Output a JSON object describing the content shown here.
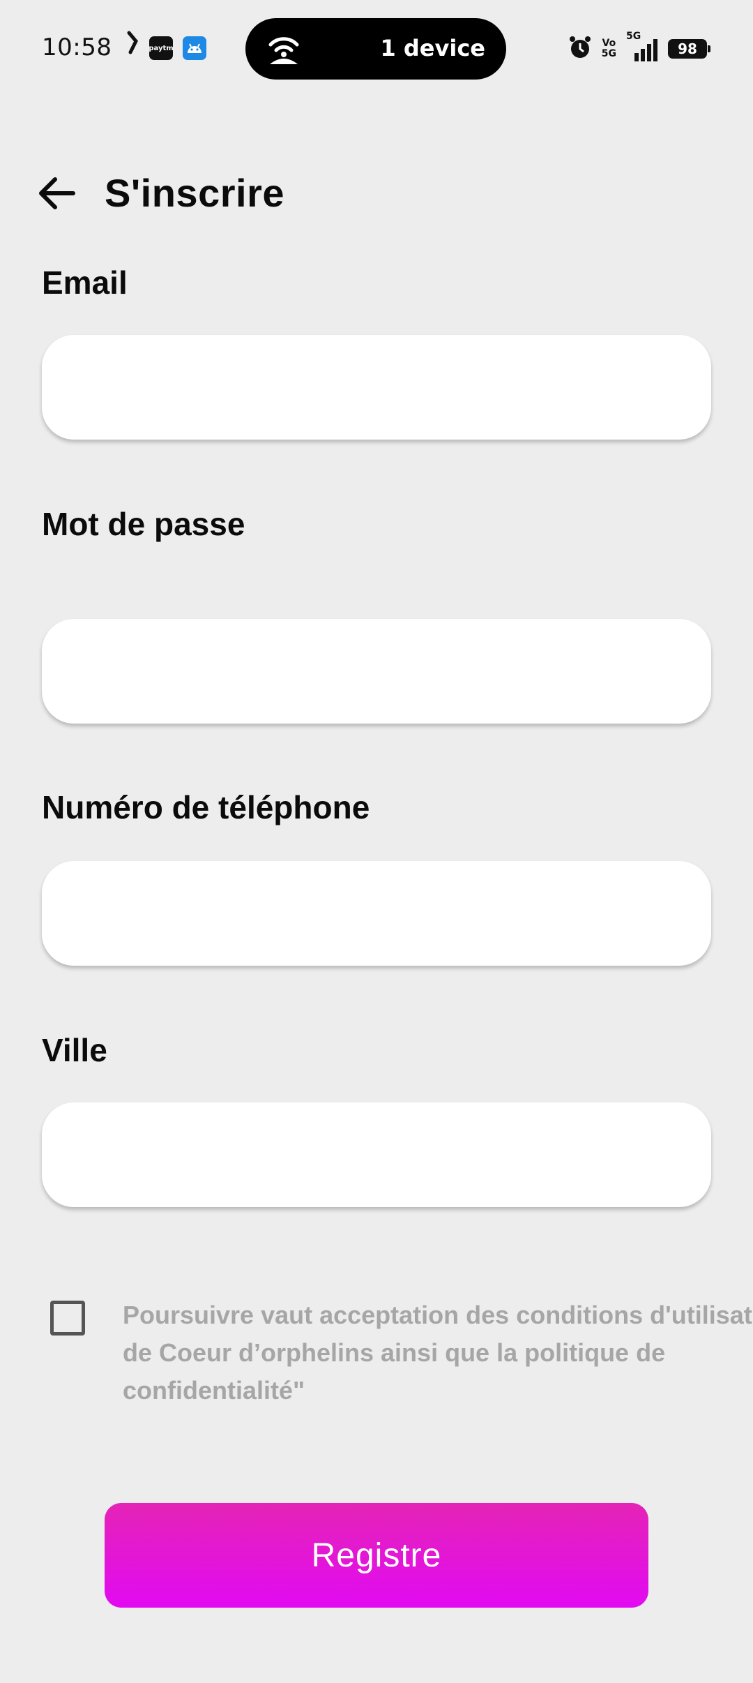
{
  "status_bar": {
    "time": "10:58",
    "paytm_label": "paytm",
    "hotspot_text": "1 device",
    "volte_line1": "Vo",
    "volte_line2": "5G",
    "network_label": "5G",
    "battery": "98",
    "icons": [
      "k-icon",
      "paytm-icon",
      "android-icon",
      "hotspot-icon",
      "alarm-icon",
      "volte-icon",
      "signal-icon",
      "battery-icon"
    ]
  },
  "header": {
    "title": "S'inscrire",
    "back_icon": "arrow-left-icon"
  },
  "form": {
    "email": {
      "label": "Email",
      "value": "",
      "placeholder": ""
    },
    "password": {
      "label": "Mot de passe",
      "value": "",
      "placeholder": ""
    },
    "phone": {
      "label": "Numéro de téléphone",
      "value": "",
      "placeholder": ""
    },
    "city": {
      "label": "Ville",
      "value": "",
      "placeholder": ""
    }
  },
  "terms": {
    "checked": false,
    "text": "Poursuivre vaut acceptation des conditions d'utilisation de Coeur d’orphelins ainsi que la politique de confidentialité\""
  },
  "register_button": {
    "label": "Registre"
  },
  "colors": {
    "background": "#ededed",
    "accent_top": "#e424b6",
    "accent_bottom": "#e20af2",
    "terms_text": "#a6a6a6"
  }
}
